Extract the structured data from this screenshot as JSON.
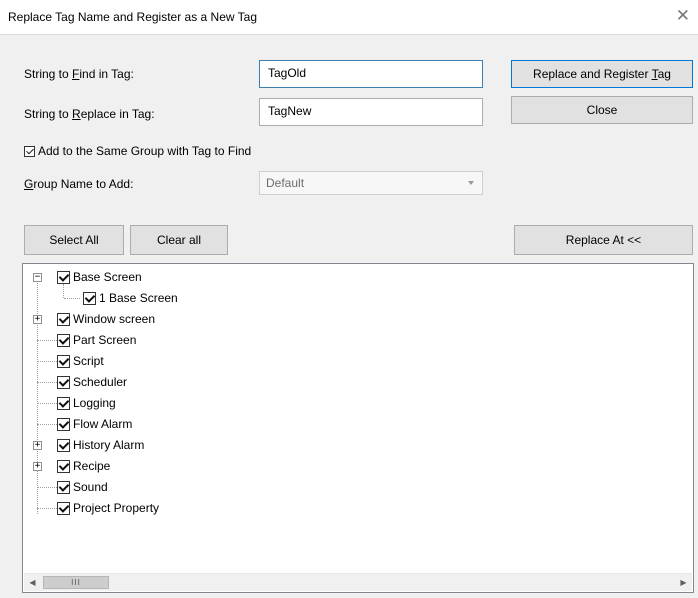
{
  "window": {
    "title": "Replace Tag Name and Register as a New Tag",
    "close_glyph": "✕"
  },
  "form": {
    "find_label_before": "String to ",
    "find_label_key": "F",
    "find_label_after": "ind in Tag:",
    "find_value": "TagOld",
    "replace_label_before": "String to ",
    "replace_label_key": "R",
    "replace_label_after": "eplace in Tag:",
    "replace_value": "TagNew",
    "same_group_checked": true,
    "same_group_label": "Add to the Same Group with Tag to Find",
    "group_label_key": "G",
    "group_label_after": "roup Name to Add:",
    "group_value": "Default"
  },
  "buttons": {
    "replace_register_before": "Replace and Register ",
    "replace_register_key": "T",
    "replace_register_after": "ag",
    "close": "Close",
    "select_all": "Select All",
    "clear_all": "Clear all",
    "replace_at": "Replace At <<"
  },
  "tree": {
    "items": [
      {
        "label": "Base Screen",
        "checked": true,
        "expander": "−"
      },
      {
        "label": "1 Base Screen",
        "checked": true
      },
      {
        "label": "Window screen",
        "checked": true,
        "expander": "+"
      },
      {
        "label": "Part Screen",
        "checked": true
      },
      {
        "label": "Script",
        "checked": true
      },
      {
        "label": "Scheduler",
        "checked": true
      },
      {
        "label": "Logging",
        "checked": true
      },
      {
        "label": "Flow Alarm",
        "checked": true
      },
      {
        "label": "History Alarm",
        "checked": true,
        "expander": "+"
      },
      {
        "label": "Recipe",
        "checked": true,
        "expander": "+"
      },
      {
        "label": "Sound",
        "checked": true
      },
      {
        "label": "Project Property",
        "checked": true
      }
    ],
    "scroll_left": "◀",
    "scroll_right": "▶",
    "thumb_grip": "III"
  }
}
